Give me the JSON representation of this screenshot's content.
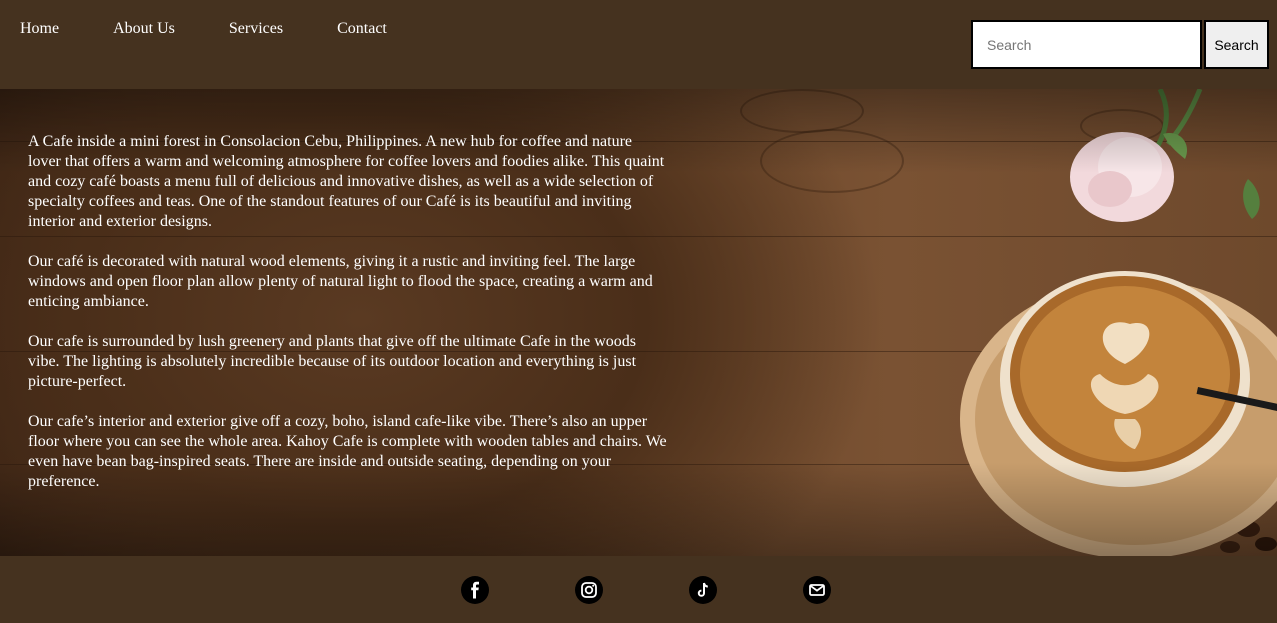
{
  "nav": {
    "items": [
      {
        "label": "Home"
      },
      {
        "label": "About Us"
      },
      {
        "label": "Services"
      },
      {
        "label": "Contact"
      }
    ]
  },
  "search": {
    "placeholder": "Search",
    "value": "",
    "button_label": "Search"
  },
  "content": {
    "paragraphs": [
      "A Cafe inside a mini forest in Consolacion Cebu, Philippines. A new hub for coffee and nature lover that offers a warm and welcoming atmosphere for coffee lovers and foodies alike. This quaint and cozy café boasts a menu full of delicious and innovative dishes, as well as a wide selection of specialty coffees and teas. One of the standout features of our Café is its beautiful and inviting interior and exterior designs.",
      "Our café is decorated with natural wood elements, giving it a rustic and inviting feel. The large windows and open floor plan allow plenty of natural light to flood the space, creating a warm and enticing ambiance.",
      "Our cafe is surrounded by lush greenery and plants that give off the ultimate Cafe in the woods vibe. The lighting is absolutely incredible because of its outdoor location and everything is just picture-perfect.",
      "Our cafe’s interior and exterior give off a cozy, boho, island cafe-like vibe. There’s also an upper floor where you can see the whole area. Kahoy Cafe is complete with wooden tables and chairs. We even have bean bag-inspired seats. There are inside and outside seating, depending on your preference."
    ]
  },
  "footer": {
    "icons": [
      "facebook-icon",
      "instagram-icon",
      "tiktok-icon",
      "email-icon"
    ]
  },
  "colors": {
    "header_bg": "#45321f",
    "footer_bg": "#45321f",
    "text": "#ffffff"
  }
}
